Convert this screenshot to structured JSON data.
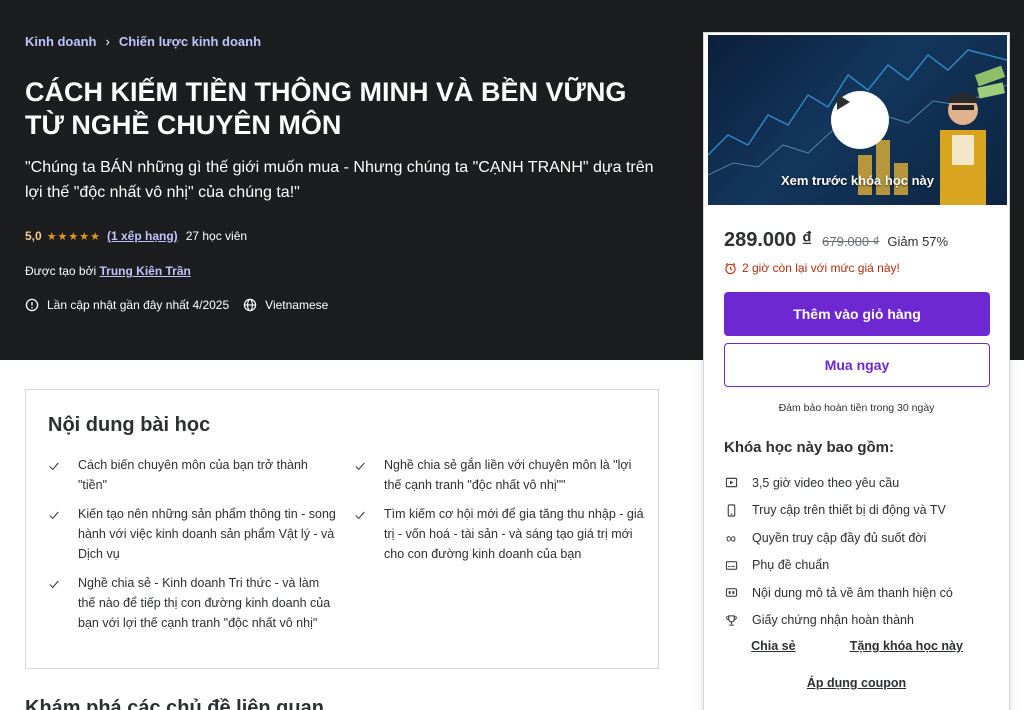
{
  "breadcrumb": {
    "items": [
      "Kinh doanh",
      "Chiến lược kinh doanh"
    ]
  },
  "course": {
    "title": "CÁCH KIẾM TIỀN THÔNG MINH VÀ BỀN VỮNG TỪ NGHỀ CHUYÊN MÔN",
    "subtitle": "\"Chúng ta BÁN những gì thế giới muốn mua - Nhưng chúng ta \"CẠNH TRANH\" dựa trên lợi thế \"độc nhất vô nhị\" của chúng ta!\"",
    "rating": "5,0",
    "stars": "★★★★★",
    "rating_count": "(1 xếp hạng)",
    "students": "27 học viên",
    "created_by_label": "Được tạo bởi",
    "instructor": "Trung Kiên Trần",
    "last_updated": "Lần cập nhật gần đây nhất 4/2025",
    "language": "Vietnamese"
  },
  "sidebar": {
    "preview_label": "Xem trước khóa học này",
    "price": "289.000 ₫",
    "old_price": "679.000 ₫",
    "discount": "Giảm 57%",
    "timer": "2 giờ còn lại với mức giá này!",
    "add_to_cart": "Thêm vào giỏ hàng",
    "buy_now": "Mua ngay",
    "guarantee": "Đảm bảo hoàn tiền trong 30 ngày",
    "includes_title": "Khóa học này bao gồm:",
    "includes": [
      {
        "icon": "video-icon",
        "label": "3,5 giờ video theo yêu cầu"
      },
      {
        "icon": "mobile-icon",
        "label": "Truy cập trên thiết bị di động và TV"
      },
      {
        "icon": "infinity-icon",
        "label": "Quyền truy cập đầy đủ suốt đời"
      },
      {
        "icon": "closed-captions-icon",
        "label": "Phụ đề chuẩn"
      },
      {
        "icon": "audio-description-icon",
        "label": "Nội dung mô tả về âm thanh hiện có"
      },
      {
        "icon": "trophy-icon",
        "label": "Giấy chứng nhận hoàn thành"
      }
    ],
    "share": "Chia sẻ",
    "gift": "Tặng khóa học này",
    "coupon": "Áp dụng coupon"
  },
  "learn": {
    "title": "Nội dung bài học",
    "left": [
      "Cách biến chuyên môn của bạn trở thành \"tiền\"",
      "Kiến tạo nên những sản phẩm thông tin - song hành với việc kinh doanh sản phẩm Vật lý - và Dịch vụ",
      "Nghề chia sẻ - Kinh doanh Tri thức - và làm thế nào để tiếp thị con đường kinh doanh của bạn với lợi thế cạnh tranh \"độc nhất vô nhị\""
    ],
    "right": [
      "Nghề chia sẻ gắn liền với chuyên môn là \"lợi thế cạnh tranh \"độc nhất vô nhị\"\"",
      "Tìm kiếm cơ hội mới để gia tăng thu nhập - giá trị - vốn hoá - tài sản - và sáng tạo giá trị mới cho con đường kinh doanh của bạn"
    ]
  },
  "related": {
    "title": "Khám phá các chủ đề liên quan"
  },
  "colors": {
    "hero_bg": "#1c1d1f",
    "accent": "#6d28d2",
    "link_light": "#c0c4fc",
    "star": "#e59819",
    "alert": "#b32d0f"
  }
}
